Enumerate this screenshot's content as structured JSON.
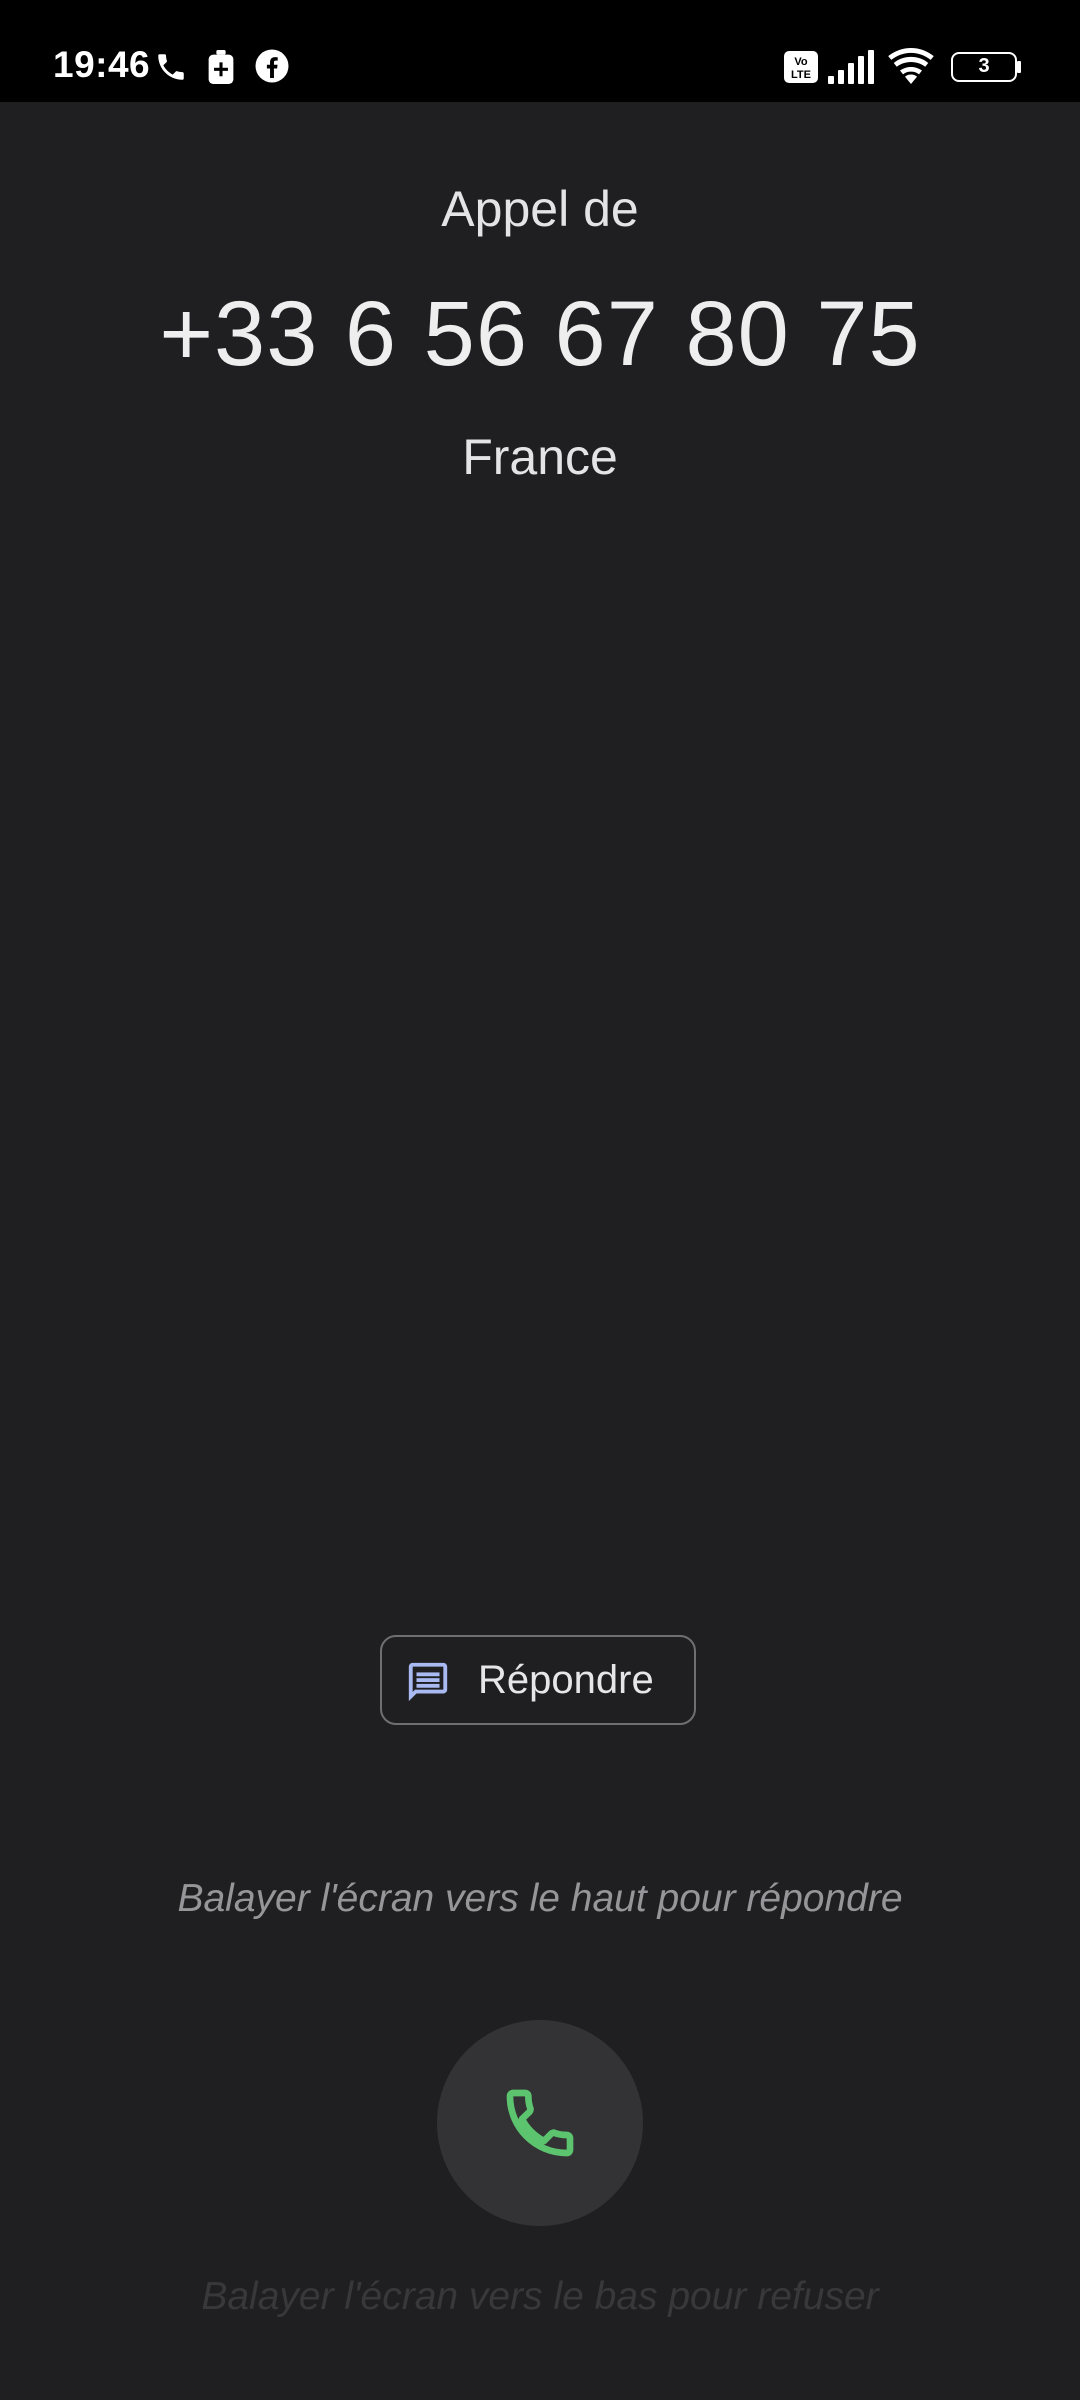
{
  "status_bar": {
    "time": "19:46",
    "battery_level": "3",
    "left_icons": [
      "phone-icon",
      "battery-saver-icon",
      "facebook-icon"
    ],
    "right_icons": [
      "volte-icon",
      "signal-icon",
      "wifi-icon",
      "battery-icon"
    ]
  },
  "call": {
    "label": "Appel de",
    "number": "+33 6 56 67 80 75",
    "location": "France"
  },
  "actions": {
    "reply_label": "Répondre",
    "reply_icon": "message-icon",
    "answer_icon": "phone-icon",
    "swipe_up_hint": "Balayer l'écran vers le haut pour répondre",
    "swipe_down_hint": "Balayer l'écran vers le bas pour refuser"
  },
  "colors": {
    "background": "#1f1f21",
    "status_bar": "#000000",
    "answer_green": "#5cc46e",
    "reply_icon_blue": "#a9b9f2"
  }
}
